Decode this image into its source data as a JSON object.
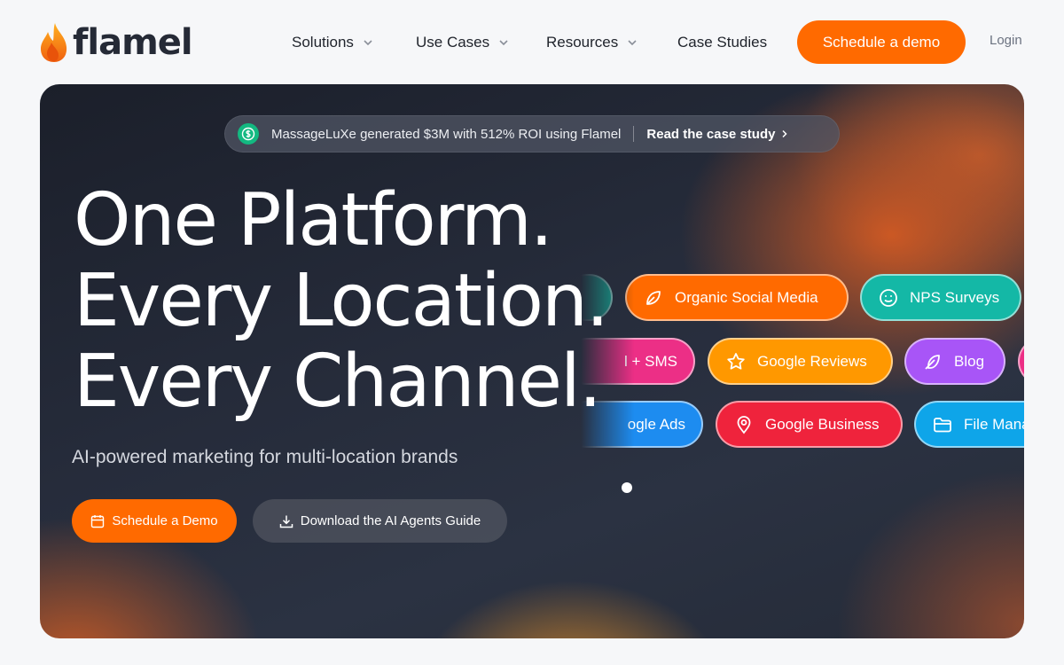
{
  "brand": {
    "name": "flamel"
  },
  "nav": {
    "solutions": "Solutions",
    "use_cases": "Use Cases",
    "resources": "Resources",
    "case_studies": "Case Studies",
    "schedule_demo": "Schedule a demo",
    "login": "Login"
  },
  "announcement": {
    "icon": "dollar-icon",
    "message": "MassageLuXe generated $3M with 512% ROI using Flamel",
    "link": "Read the case study"
  },
  "hero": {
    "line1": "One Platform.",
    "line2": "Every Location.",
    "line3": "Every Channel.",
    "subtitle": "AI-powered marketing for multi-location brands",
    "cta_primary": "Schedule a Demo",
    "cta_secondary": "Download the AI Agents Guide"
  },
  "channels": {
    "row1": [
      {
        "label": "",
        "color": "#12b8a0",
        "icon": "partial"
      },
      {
        "label": "Organic Social Media",
        "color": "#ff6a00",
        "icon": "leaf-icon"
      },
      {
        "label": "NPS Surveys",
        "color": "#14b8a6",
        "icon": "smile-icon"
      }
    ],
    "row2": [
      {
        "label": "l + SMS",
        "color": "#ec2f86",
        "icon": "none"
      },
      {
        "label": "Google Reviews",
        "color": "#ff9800",
        "icon": "star-icon"
      },
      {
        "label": "Blog",
        "color": "#a855f7",
        "icon": "feather-icon"
      },
      {
        "label": "",
        "color": "#ec2f86",
        "icon": "mail-icon"
      }
    ],
    "row3": [
      {
        "label": "ogle Ads",
        "color": "#1d8cf0",
        "icon": "none"
      },
      {
        "label": "Google Business",
        "color": "#ef233c",
        "icon": "map-pin-icon"
      },
      {
        "label": "File Managem",
        "color": "#0ea5e9",
        "icon": "folder-icon"
      }
    ]
  },
  "colors": {
    "accent": "#ff6a00",
    "hero_bg": "#262c3b"
  }
}
